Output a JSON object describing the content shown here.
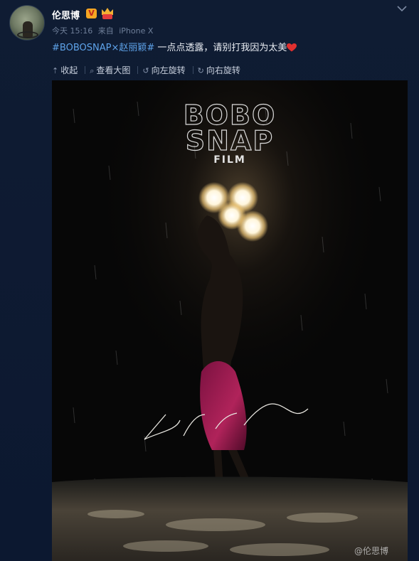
{
  "post": {
    "username": "伦思博",
    "verified_badge": "V",
    "time": "今天 15:16",
    "source_prefix": "来自",
    "source": "iPhone X",
    "hashtag": "#BOBOSNAP×赵丽颖#",
    "text": " 一点点透露，请别打我因为太美",
    "heart_color": "#e0302f",
    "tag_color": "#5ea3ea"
  },
  "actions": [
    {
      "icon": "collapse-icon",
      "label": "收起"
    },
    {
      "icon": "zoom-icon",
      "label": "查看大图"
    },
    {
      "icon": "rotate-left-icon",
      "label": "向左旋转"
    },
    {
      "icon": "rotate-right-icon",
      "label": "向右旋转"
    }
  ],
  "image": {
    "logo_line1": "BOBO",
    "logo_line2": "SNAP",
    "logo_line3": "FILM",
    "signature": "Zhao Li Ying",
    "watermark": "@伦思博"
  }
}
